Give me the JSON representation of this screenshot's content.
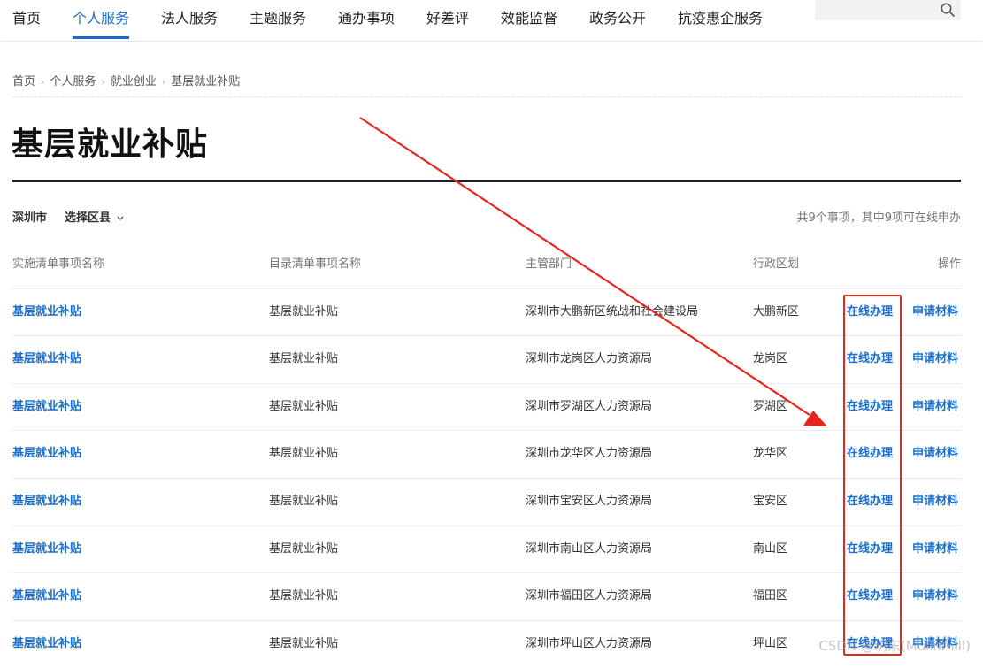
{
  "nav": {
    "items": [
      "首页",
      "个人服务",
      "法人服务",
      "主题服务",
      "通办事项",
      "好差评",
      "效能监督",
      "政务公开",
      "抗疫惠企服务"
    ],
    "active": "个人服务",
    "search_icon": "search-icon"
  },
  "breadcrumb": [
    "首页",
    "个人服务",
    "就业创业",
    "基层就业补贴"
  ],
  "page_title": "基层就业补贴",
  "filter": {
    "city": "深圳市",
    "district_label": "选择区县",
    "district_icon": "chevron-down-icon"
  },
  "summary": "共9个事项，其中9项可在线申办",
  "table": {
    "headers": [
      "实施清单事项名称",
      "目录清单事项名称",
      "主管部门",
      "行政区划",
      "操作"
    ],
    "rows": [
      {
        "impl_name": "基层就业补贴",
        "catalog_name": "基层就业补贴",
        "department": "深圳市大鹏新区统战和社会建设局",
        "district": "大鹏新区",
        "online": "在线办理",
        "materials": "申请材料"
      },
      {
        "impl_name": "基层就业补贴",
        "catalog_name": "基层就业补贴",
        "department": "深圳市龙岗区人力资源局",
        "district": "龙岗区",
        "online": "在线办理",
        "materials": "申请材料"
      },
      {
        "impl_name": "基层就业补贴",
        "catalog_name": "基层就业补贴",
        "department": "深圳市罗湖区人力资源局",
        "district": "罗湖区",
        "online": "在线办理",
        "materials": "申请材料"
      },
      {
        "impl_name": "基层就业补贴",
        "catalog_name": "基层就业补贴",
        "department": "深圳市龙华区人力资源局",
        "district": "龙华区",
        "online": "在线办理",
        "materials": "申请材料"
      },
      {
        "impl_name": "基层就业补贴",
        "catalog_name": "基层就业补贴",
        "department": "深圳市宝安区人力资源局",
        "district": "宝安区",
        "online": "在线办理",
        "materials": "申请材料"
      },
      {
        "impl_name": "基层就业补贴",
        "catalog_name": "基层就业补贴",
        "department": "深圳市南山区人力资源局",
        "district": "南山区",
        "online": "在线办理",
        "materials": "申请材料"
      },
      {
        "impl_name": "基层就业补贴",
        "catalog_name": "基层就业补贴",
        "department": "深圳市福田区人力资源局",
        "district": "福田区",
        "online": "在线办理",
        "materials": "申请材料"
      },
      {
        "impl_name": "基层就业补贴",
        "catalog_name": "基层就业补贴",
        "department": "深圳市坪山区人力资源局",
        "district": "坪山区",
        "online": "在线办理",
        "materials": "申请材料"
      }
    ]
  },
  "annotation": {
    "color": "#e8271c"
  },
  "watermark": "CSDN @明东(Mulinmill)",
  "colors": {
    "accent": "#1a6fce",
    "title_rule": "#1b1f2a"
  }
}
